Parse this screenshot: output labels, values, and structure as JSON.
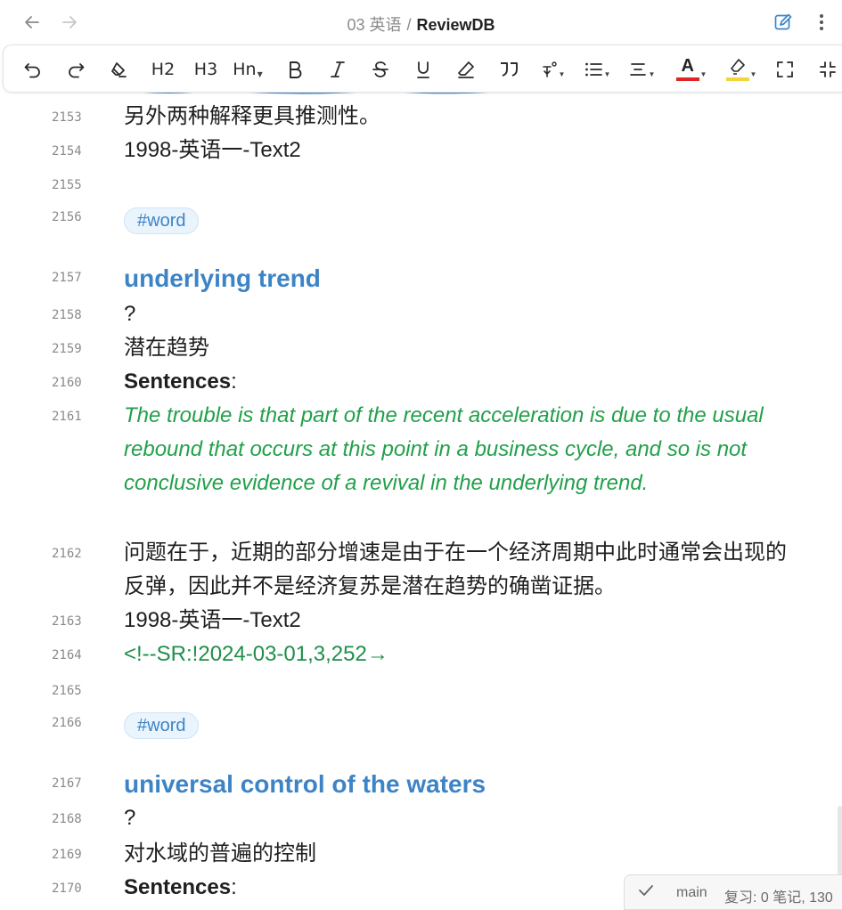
{
  "header": {
    "breadcrumb_parent": "03 英语",
    "breadcrumb_sep": "/",
    "breadcrumb_current": "ReviewDB",
    "icons": [
      "arrow-left-icon",
      "arrow-right-icon",
      "edit-icon",
      "more-vertical-icon"
    ]
  },
  "toolbar": {
    "h2": "H2",
    "h3": "H3",
    "hn": "Hn",
    "text_color_letter": "A",
    "text_color": "#e02424",
    "highlight_color": "#f2d43c",
    "icons": [
      "undo-icon",
      "redo-icon",
      "clear-format-icon",
      "bold-icon",
      "italic-icon",
      "strikethrough-icon",
      "underline-icon",
      "eraser-icon",
      "quote-icon",
      "ruby-icon",
      "list-icon",
      "align-icon",
      "text-color-icon",
      "highlight-icon",
      "fullscreen-icon",
      "collapse-icon"
    ]
  },
  "lines": [
    {
      "num": "2153",
      "text": "另外两种解释更具推测性。"
    },
    {
      "num": "2154",
      "text": "1998-英语一-Text2"
    },
    {
      "num": "2155",
      "text": ""
    },
    {
      "num": "2156",
      "tag": "#word"
    },
    {
      "num": "2157",
      "heading": "underlying trend"
    },
    {
      "num": "2158",
      "text": "?"
    },
    {
      "num": "2159",
      "text": "潜在趋势"
    },
    {
      "num": "2160",
      "bold": "Sentences",
      "suffix": ":"
    },
    {
      "num": "2161",
      "italic": "The trouble is that part of the recent acceleration is due to the usual rebound that occurs at this point in a business cycle, and so is not conclusive evidence of a revival in the underlying trend."
    },
    {
      "num": "2162",
      "text": "问题在于，近期的部分增速是由于在一个经济周期中此时通常会出现的反弹，因此并不是经济复苏是潜在趋势的确凿证据。"
    },
    {
      "num": "2163",
      "text": "1998-英语一-Text2"
    },
    {
      "num": "2164",
      "comment": "<!--SR:!2024-03-01,3,252→"
    },
    {
      "num": "2165",
      "text": ""
    },
    {
      "num": "2166",
      "tag": "#word"
    },
    {
      "num": "2167",
      "heading": "universal control of the waters"
    },
    {
      "num": "2168",
      "text": "?"
    },
    {
      "num": "2169",
      "text": "对水域的普遍的控制"
    },
    {
      "num": "2170",
      "bold": "Sentences",
      "suffix": ":"
    }
  ],
  "status": {
    "branch": "main",
    "review": "复习: 0 笔记, 130"
  },
  "colors": {
    "heading": "#3d84c6",
    "italic": "#22a04b",
    "tag_bg": "#eaf4fd"
  }
}
